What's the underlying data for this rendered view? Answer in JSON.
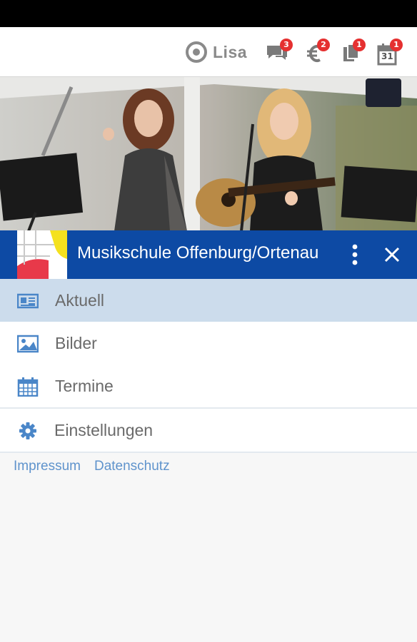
{
  "topbar": {
    "user": {
      "name": "Lisa",
      "icon": "user-switch-icon"
    },
    "notifications": [
      {
        "icon": "chat-icon",
        "count": "3"
      },
      {
        "icon": "euro-icon",
        "count": "2"
      },
      {
        "icon": "documents-icon",
        "count": "1"
      },
      {
        "icon": "calendar-icon",
        "count": "1",
        "day": "31"
      }
    ]
  },
  "hero": {
    "description": "stage-photo"
  },
  "header": {
    "title": "Musikschule Offenburg/Ortenau",
    "brand_color": "#0d4aa4"
  },
  "menu": {
    "items": [
      {
        "label": "Aktuell",
        "icon": "newspaper-icon",
        "active": true
      },
      {
        "label": "Bilder",
        "icon": "image-icon",
        "active": false
      },
      {
        "label": "Termine",
        "icon": "calendar-icon",
        "active": false
      }
    ],
    "settings": {
      "label": "Einstellungen",
      "icon": "gear-icon"
    }
  },
  "footer": {
    "links": [
      "Impressum",
      "Datenschutz"
    ]
  },
  "colors": {
    "accent": "#4a86c8",
    "active_bg": "#ccdcec",
    "badge": "#e53030"
  }
}
